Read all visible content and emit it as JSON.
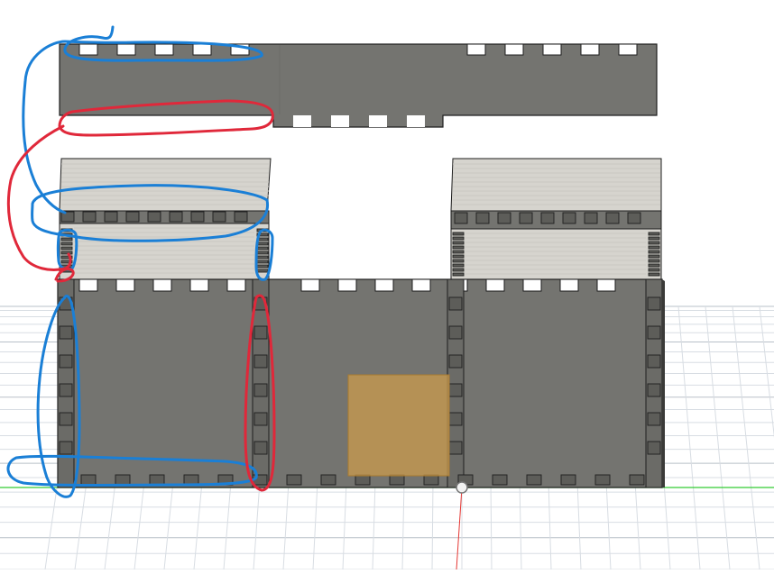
{
  "viewport": {
    "background": "#ffffff",
    "grid_minor_color": "#d8dde3",
    "grid_major_color": "#b9c0c8",
    "x_axis_color": "#33cc33",
    "z_axis_color": "#e53935",
    "y_axis_color": "#2b2bb8"
  },
  "model": {
    "panel_color": "#747470",
    "panel_shade_color": "#6b6b67",
    "panel_edge_color": "#1e1e1e",
    "finger_slot_color": "#5d5d59",
    "top_face_color": "#d6d4ce",
    "top_face_stripe_color": "#c9c7c1",
    "selected_face_color": "#c89a4e",
    "selected_face_opacity": 0.78
  },
  "annotations": {
    "blue_stroke_color": "#1a7fd6",
    "red_stroke_color": "#e0283a"
  },
  "origin_point": {
    "fill": "#f2f2f2",
    "stroke": "#777777"
  }
}
